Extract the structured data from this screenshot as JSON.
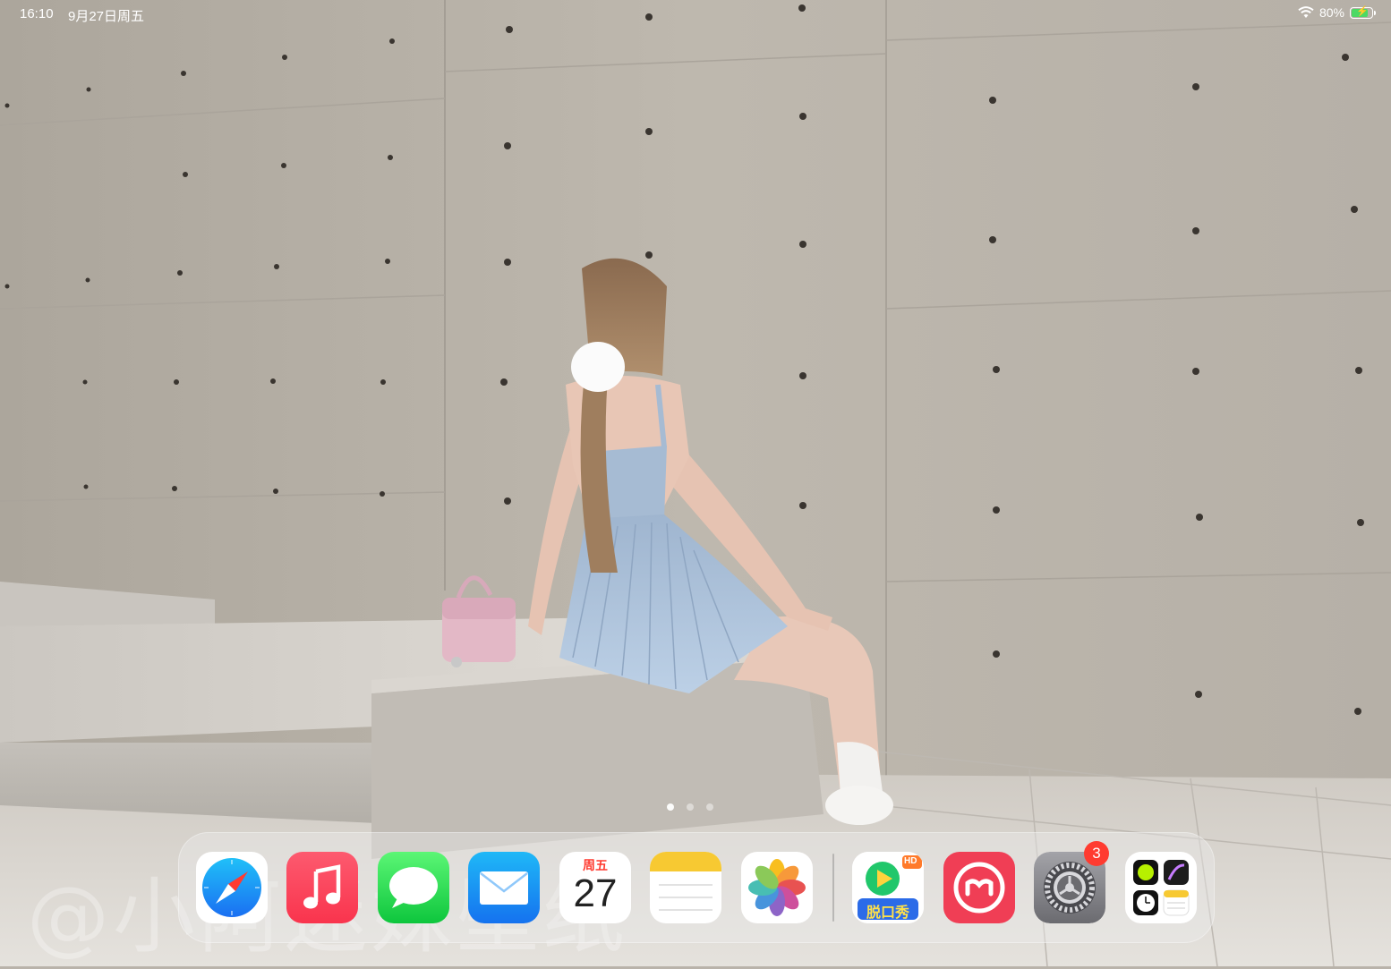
{
  "status_bar": {
    "time": "16:10",
    "date": "9月27日周五",
    "battery_percent": "80%",
    "battery_level": 0.8,
    "wifi_icon": "wifi-icon",
    "battery_icon": "battery-charging-icon"
  },
  "home": {
    "page_count": 3,
    "current_page": 1
  },
  "dock": {
    "apps": [
      {
        "name": "Safari",
        "icon": "compass-icon",
        "color": "#1e8ef5"
      },
      {
        "name": "音乐",
        "icon": "music-note-icon",
        "color": "#fb3b57"
      },
      {
        "name": "信息",
        "icon": "speech-bubble-icon",
        "color": "#35c759"
      },
      {
        "name": "邮件",
        "icon": "envelope-icon",
        "color": "#1b8cf3"
      },
      {
        "name": "日历",
        "icon": "calendar-icon",
        "day": "周五",
        "date": "27"
      },
      {
        "name": "备忘录",
        "icon": "notes-icon",
        "color": "#f7c932"
      },
      {
        "name": "照片",
        "icon": "photos-flower-icon"
      },
      {
        "name": "脱口秀",
        "icon": "play-icon",
        "label": "脱口秀",
        "hd": "HD"
      },
      {
        "name": "美图秀秀",
        "icon": "meitu-icon",
        "color": "#f03e55"
      },
      {
        "name": "设置",
        "icon": "gear-icon",
        "badge": "3"
      },
      {
        "name": "App Library",
        "icon": "app-library-icon"
      }
    ]
  },
  "watermark": "@小阿迷妹壁纸"
}
